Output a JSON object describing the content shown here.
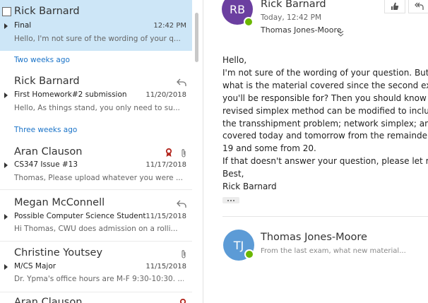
{
  "messages": [
    {
      "sender": "Rick Barnard",
      "subject": "Final",
      "date": "12:42 PM",
      "preview": "Hello,  I'm not sure of the wording of your q..."
    },
    {
      "sender": "Rick Barnard",
      "subject": "First Homework#2 submission",
      "date": "11/20/2018",
      "preview": "Hello,  As things stand, you only need to su..."
    },
    {
      "sender": "Aran Clauson",
      "subject": "CS347 Issue #13",
      "date": "11/17/2018",
      "preview": "Thomas,  Please upload whatever you were ..."
    },
    {
      "sender": "Megan McConnell",
      "subject": "Possible Computer Science Student",
      "date": "11/15/2018",
      "preview": "Hi Thomas,  CWU does admission on a rolli..."
    },
    {
      "sender": "Christine Youtsey",
      "subject": "M/CS Major",
      "date": "11/15/2018",
      "preview": "Dr. Ypma's office hours are M-F 9:30-10:30. ..."
    },
    {
      "sender": "Aran Clauson"
    }
  ],
  "groups": {
    "two_weeks": "Two weeks ago",
    "three_weeks": "Three weeks ago"
  },
  "reading": {
    "avatar_initials": "RB",
    "from": "Rick Barnard",
    "time": "Today, 12:42 PM",
    "to": "Thomas Jones-Moore",
    "body": [
      "Hello,",
      "I'm not sure of the wording of your question.  But",
      "what is the material covered since the second exam",
      "you'll be responsible for? Then you should know how",
      "revised simplex method can be modified to include",
      "the transshipment problem; network simplex; and",
      "covered today and tomorrow from the remainder",
      "19 and some from 20.",
      "If that doesn't answer your question, please let me",
      "Best,",
      "Rick Barnard"
    ],
    "reply_avatar_initials": "TJ",
    "reply_name": "Thomas Jones-Moore",
    "reply_preview": "From the last exam, what new material..."
  },
  "colors": {
    "selected_bg": "#cde6f7",
    "group_header": "#1a73c8",
    "avatar_rb": "#6b3fa0",
    "avatar_tj": "#5c9bd6",
    "presence": "#6bb700",
    "flag_red": "#b3261e"
  },
  "icons": {
    "reply": "reply-icon",
    "attachment": "paperclip-icon",
    "flag": "ribbon-icon",
    "expand": "chevron-down-icon",
    "like": "thumbs-up-icon",
    "reply_all": "reply-all-icon"
  }
}
